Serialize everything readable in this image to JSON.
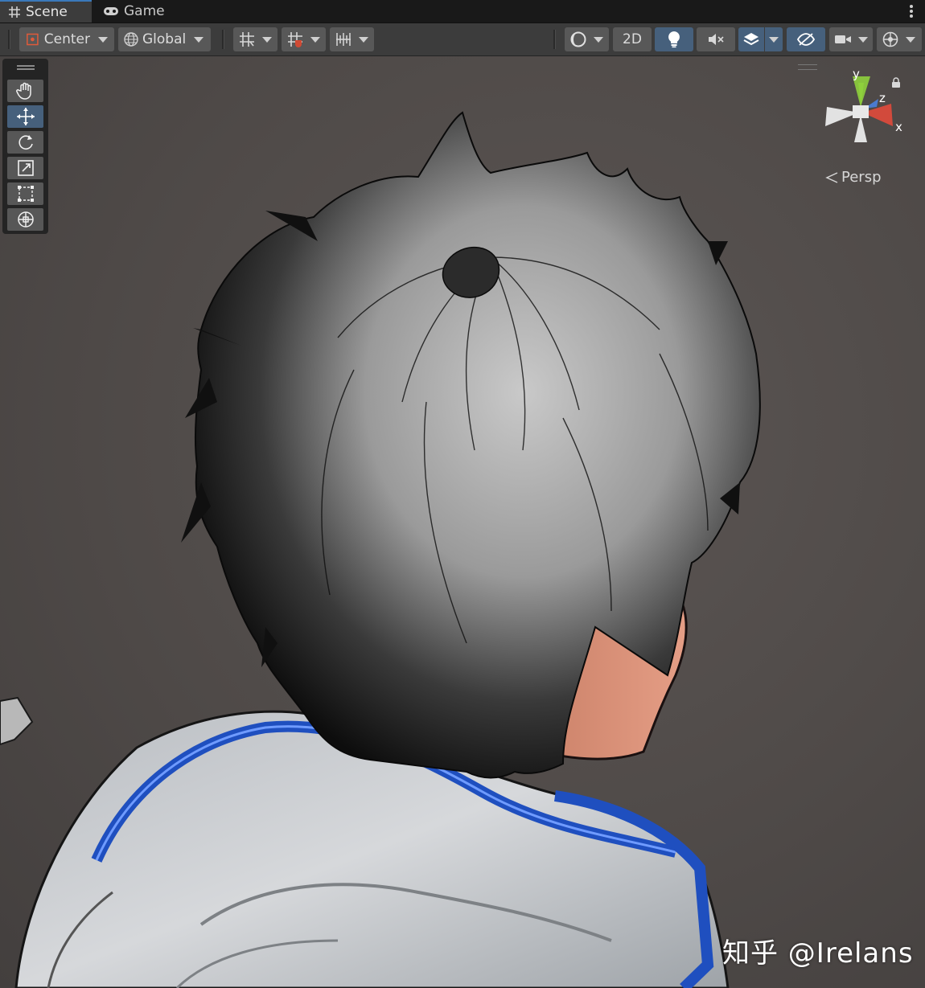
{
  "tabs": {
    "scene_label": "Scene",
    "game_label": "Game"
  },
  "toolbar": {
    "pivot_label": "Center",
    "space_label": "Global",
    "toggle_2d_label": "2D"
  },
  "gizmo": {
    "axis_y": "y",
    "axis_z": "z",
    "axis_x": "x",
    "projection_label": "Persp"
  },
  "watermark": {
    "text": "知乎 @Irelans"
  },
  "colors": {
    "accent_blue": "#46607c",
    "axis_y": "#8ecf3c",
    "axis_x": "#d24a3c",
    "axis_z": "#4a7bd0"
  },
  "icons": [
    "hand-tool-icon",
    "move-tool-icon",
    "rotate-tool-icon",
    "scale-tool-icon",
    "rect-tool-icon",
    "transform-tool-icon",
    "grid-icon",
    "snap-icon",
    "increment-snap-icon",
    "shading-mode-icon",
    "lighting-icon",
    "audio-icon",
    "effects-icon",
    "visibility-icon",
    "camera-icon",
    "gizmos-icon",
    "lock-icon"
  ]
}
